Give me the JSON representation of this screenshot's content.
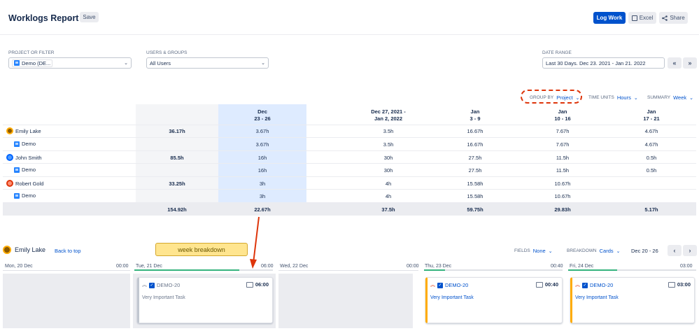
{
  "header": {
    "title": "Worklogs Report",
    "save_label": "Save",
    "log_work_label": "Log Work",
    "excel_label": "Excel",
    "share_label": "Share"
  },
  "filters": {
    "project_label": "PROJECT OR FILTER",
    "project_value": "Demo (DE...",
    "users_label": "USERS & GROUPS",
    "users_value": "All Users",
    "date_label": "DATE RANGE",
    "date_value": "Last 30 Days. Dec 23. 2021 - Jan 21. 2022",
    "prev_label": "«",
    "next_label": "»"
  },
  "options": {
    "group_by_label": "GROUP BY",
    "group_by_value": "Project",
    "time_units_label": "TIME UNITS",
    "time_units_value": "Hours",
    "summary_label": "SUMMARY",
    "summary_value": "Week"
  },
  "table": {
    "columns": [
      {
        "line1": "Dec",
        "line2": "23 - 26"
      },
      {
        "line1": "Dec 27, 2021 -",
        "line2": "Jan 2, 2022"
      },
      {
        "line1": "Jan",
        "line2": "3 - 9"
      },
      {
        "line1": "Jan",
        "line2": "10 - 16"
      },
      {
        "line1": "Jan",
        "line2": "17 - 21"
      }
    ],
    "rows": [
      {
        "name": "Emily Lake",
        "total": "36.17h",
        "values": [
          "3.67h",
          "3.5h",
          "16.67h",
          "7.67h",
          "4.67h"
        ]
      },
      {
        "name": "Demo",
        "total": "",
        "values": [
          "3.67h",
          "3.5h",
          "16.67h",
          "7.67h",
          "4.67h"
        ]
      },
      {
        "name": "John Smith",
        "total": "85.5h",
        "values": [
          "16h",
          "30h",
          "27.5h",
          "11.5h",
          "0.5h"
        ]
      },
      {
        "name": "Demo",
        "total": "",
        "values": [
          "16h",
          "30h",
          "27.5h",
          "11.5h",
          "0.5h"
        ]
      },
      {
        "name": "Robert Gold",
        "total": "33.25h",
        "values": [
          "3h",
          "4h",
          "15.58h",
          "10.67h",
          ""
        ]
      },
      {
        "name": "Demo",
        "total": "",
        "values": [
          "3h",
          "4h",
          "15.58h",
          "10.67h",
          ""
        ]
      }
    ],
    "totals": {
      "total": "154.92h",
      "values": [
        "22.67h",
        "37.5h",
        "59.75h",
        "29.83h",
        "5.17h"
      ]
    }
  },
  "breakdown": {
    "user_name": "Emily Lake",
    "back_label": "Back to top",
    "annotation": "week breakdown",
    "fields_label": "FIELDS",
    "fields_value": "None",
    "breakdown_label": "BREAKDOWN",
    "breakdown_value": "Cards",
    "week_range": "Dec 20 - 26",
    "days": [
      {
        "label": "Mon, 20 Dec",
        "time": "00:00"
      },
      {
        "label": "Tue, 21 Dec",
        "time": "06:00"
      },
      {
        "label": "Wed, 22 Dec",
        "time": "00:00"
      },
      {
        "label": "Thu, 23 Dec",
        "time": "00:40"
      },
      {
        "label": "Fri, 24 Dec",
        "time": "03:00"
      }
    ],
    "cards": [
      {
        "key": "DEMO-20",
        "time": "06:00",
        "summary": "Very Important Task"
      },
      {
        "key": "DEMO-20",
        "time": "00:40",
        "summary": "Very Important Task"
      },
      {
        "key": "DEMO-20",
        "time": "03:00",
        "summary": "Very Important Task"
      }
    ]
  },
  "colors": {
    "primary": "#0052cc",
    "highlight_column": "#deebff",
    "annotation_red": "#de350b",
    "progress_green": "#36b37e",
    "note_yellow": "#ffe58f"
  }
}
